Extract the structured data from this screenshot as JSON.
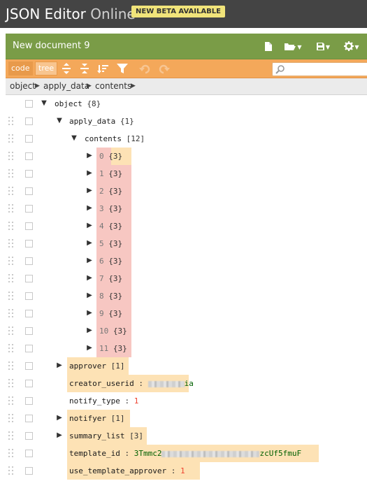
{
  "app": {
    "title_main": "JSON Editor",
    "title_light": " Online",
    "beta_badge": "NEW BETA AVAILABLE"
  },
  "document": {
    "name": "New document 9"
  },
  "toolbar": {
    "mode_code": "code",
    "mode_tree": "tree",
    "search_placeholder": ""
  },
  "breadcrumb": [
    "object",
    "apply_data",
    "contents"
  ],
  "tree": {
    "root": {
      "key": "object",
      "count": "{8}"
    },
    "apply_data": {
      "key": "apply_data",
      "count": "{1}"
    },
    "contents": {
      "key": "contents",
      "count": "[12]"
    },
    "items": [
      {
        "index": "0",
        "count": "{3}"
      },
      {
        "index": "1",
        "count": "{3}"
      },
      {
        "index": "2",
        "count": "{3}"
      },
      {
        "index": "3",
        "count": "{3}"
      },
      {
        "index": "4",
        "count": "{3}"
      },
      {
        "index": "5",
        "count": "{3}"
      },
      {
        "index": "6",
        "count": "{3}"
      },
      {
        "index": "7",
        "count": "{3}"
      },
      {
        "index": "8",
        "count": "{3}"
      },
      {
        "index": "9",
        "count": "{3}"
      },
      {
        "index": "10",
        "count": "{3}"
      },
      {
        "index": "11",
        "count": "{3}"
      }
    ],
    "approver": {
      "key": "approver",
      "count": "[1]"
    },
    "creator_userid": {
      "key": "creator_userid",
      "value_tail": "ia"
    },
    "notify_type": {
      "key": "notify_type",
      "value": "1"
    },
    "notifyer": {
      "key": "notifyer",
      "count": "[1]"
    },
    "summary_list": {
      "key": "summary_list",
      "count": "[3]"
    },
    "template_id": {
      "key": "template_id",
      "value_head": "3Tmmc2",
      "value_tail": "zcUf5fmuF"
    },
    "use_template_approver": {
      "key": "use_template_approver",
      "value": "1"
    }
  },
  "colors": {
    "header": "#444444",
    "doc_bar": "#7a9c47",
    "toolbar": "#f4a85a",
    "highlight_yellow": "#fde2b5",
    "highlight_pink": "#f7c7c2",
    "number": "#ee422e"
  }
}
